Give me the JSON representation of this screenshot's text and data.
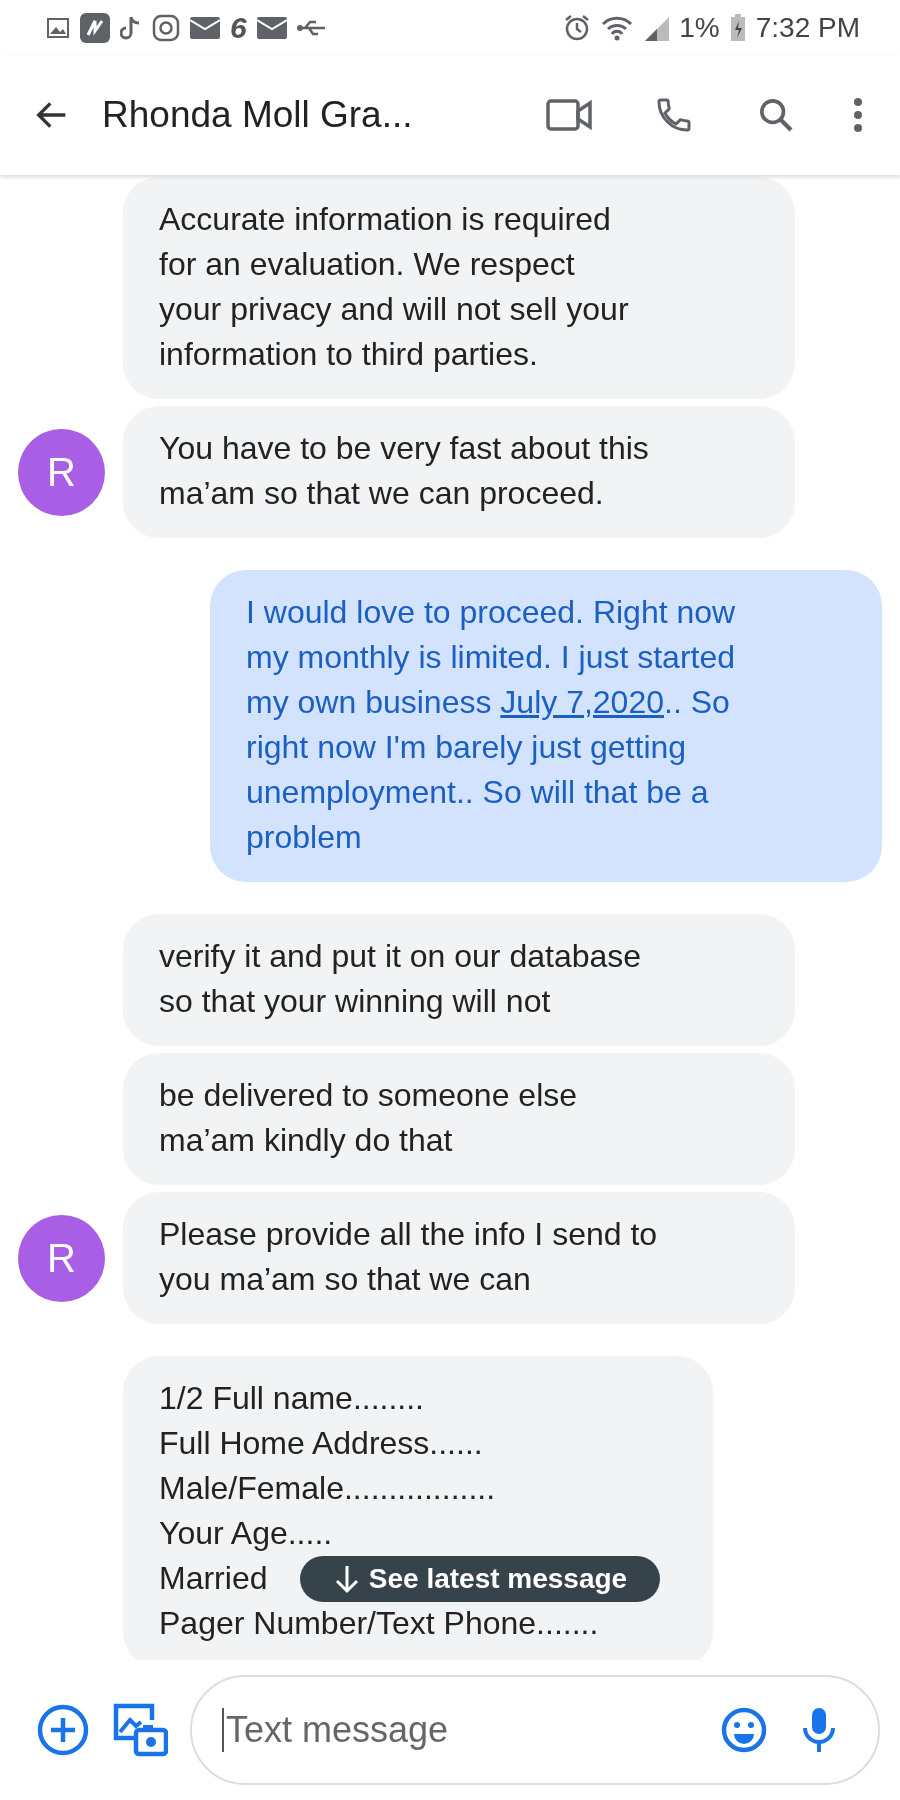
{
  "status_bar": {
    "app_digit": "6",
    "battery_text": "1%",
    "time": "7:32 PM"
  },
  "header": {
    "title": "Rhonda Moll Gra..."
  },
  "messages": [
    {
      "kind": "received",
      "lines": [
        [
          {
            "text": "Accurate information is required\nfor an evaluation. We respect\nyour privacy and will not sell your\ninformation to third parties."
          }
        ]
      ]
    },
    {
      "kind": "received",
      "avatar": "R",
      "lines": [
        [
          {
            "text": "You have to be very fast about this\nma’am so that we can proceed."
          }
        ]
      ]
    },
    {
      "kind": "sent",
      "lines": [
        [
          {
            "text": "I would love to proceed. Right now\nmy monthly is limited. I just started\nmy own business "
          },
          {
            "text": "July 7,2020",
            "link": true
          },
          {
            "text": ".. So\nright now I'm barely just getting\nunemployment.. So will that be a\nproblem"
          }
        ]
      ]
    },
    {
      "kind": "received",
      "lines": [
        [
          {
            "text": "verify it and put it on our database\nso that your winning will not"
          }
        ]
      ]
    },
    {
      "kind": "received",
      "lines": [
        [
          {
            "text": "be delivered to someone else\nma’am kindly do that"
          }
        ]
      ]
    },
    {
      "kind": "received",
      "avatar": "R",
      "lines": [
        [
          {
            "text": "Please provide all the info I send to\nyou ma’am so that we can"
          }
        ]
      ]
    },
    {
      "kind": "received",
      "lines": [
        [
          {
            "text": "1/2 Full name........"
          }
        ],
        [
          {
            "text": "Full Home Address......"
          }
        ],
        [
          {
            "text": "Male/Female................."
          }
        ],
        [
          {
            "text": "Your Age....."
          }
        ],
        [
          {
            "text": "Married"
          }
        ],
        [
          {
            "text": "Pager Number/Text Phone......."
          }
        ]
      ]
    }
  ],
  "toast": {
    "label": "See latest message"
  },
  "composer": {
    "placeholder": "Text message"
  }
}
